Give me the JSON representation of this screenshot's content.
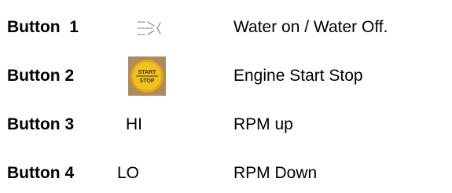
{
  "rows": [
    {
      "button": "Button  1",
      "indicator": "",
      "indicator_icon": "water-spray-icon",
      "description": "Water on / Water Off."
    },
    {
      "button": "Button 2",
      "indicator_icon": "start-stop-button-icon",
      "icon_text": {
        "top": "START",
        "bottom": "STOP"
      },
      "description": "Engine Start Stop"
    },
    {
      "button": "Button 3",
      "indicator": "HI",
      "description": "RPM up"
    },
    {
      "button": "Button 4",
      "indicator": "LO",
      "description": "RPM Down"
    }
  ],
  "colors": {
    "start_stop_yellow": "#f2c21b",
    "start_stop_bg": "#b08a5a",
    "water_icon": "#9a9a9a"
  }
}
